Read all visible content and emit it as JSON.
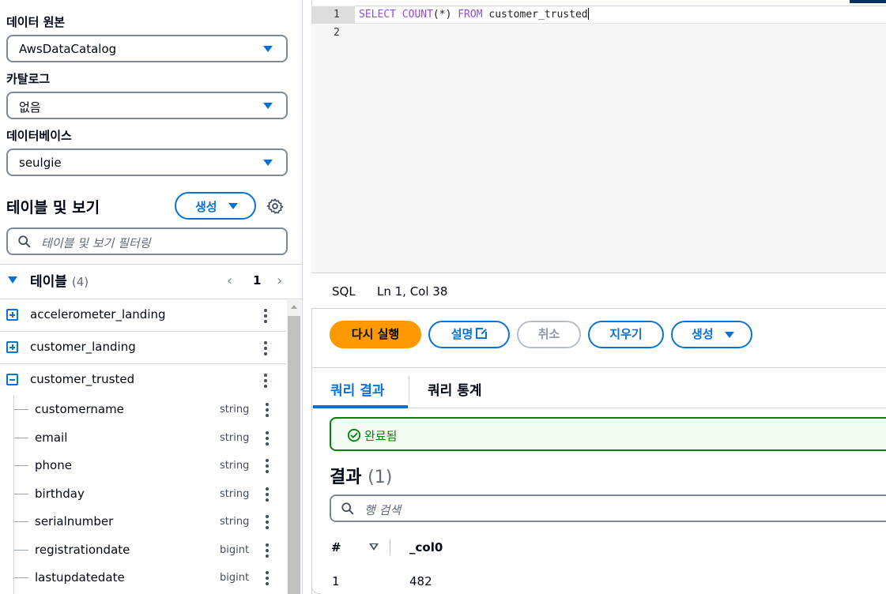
{
  "left_panel": {
    "data_source": {
      "label": "데이터 원본",
      "value": "AwsDataCatalog"
    },
    "catalog": {
      "label": "카탈로그",
      "value": "없음"
    },
    "database": {
      "label": "데이터베이스",
      "value": "seulgie"
    },
    "tables_views": {
      "title": "테이블 및 보기",
      "create_label": "생성",
      "filter_placeholder": "테이블 및 보기 필터링"
    },
    "tables_section": {
      "title": "테이블",
      "count": "(4)",
      "page": "1"
    },
    "tables": [
      {
        "name": "accelerometer_landing",
        "expanded": false
      },
      {
        "name": "customer_landing",
        "expanded": false
      },
      {
        "name": "customer_trusted",
        "expanded": true
      }
    ],
    "columns": [
      {
        "name": "customername",
        "type": "string"
      },
      {
        "name": "email",
        "type": "string"
      },
      {
        "name": "phone",
        "type": "string"
      },
      {
        "name": "birthday",
        "type": "string"
      },
      {
        "name": "serialnumber",
        "type": "string"
      },
      {
        "name": "registrationdate",
        "type": "bigint"
      },
      {
        "name": "lastupdatedate",
        "type": "bigint"
      }
    ]
  },
  "editor": {
    "lines": [
      "1",
      "2"
    ],
    "code": {
      "kw1": "SELECT COUNT",
      "p1": "(*)",
      "kw2": " FROM ",
      "p2": "customer_trusted"
    },
    "status_lang": "SQL",
    "status_pos": "Ln 1, Col 38"
  },
  "actions": {
    "run": "다시 실행",
    "explain": "설명",
    "cancel": "취소",
    "clear": "지우기",
    "create": "생성"
  },
  "results": {
    "tabs": [
      "쿼리 결과",
      "쿼리 통계"
    ],
    "status": "완료됨",
    "title": "결과",
    "count": "(1)",
    "search_placeholder": "행 검색",
    "columns": [
      "#",
      "_col0"
    ],
    "rows": [
      [
        "1",
        "482"
      ]
    ]
  },
  "colors": {
    "accent": "#0972d3",
    "run_button": "#ff9900",
    "success": "#037f0c"
  }
}
